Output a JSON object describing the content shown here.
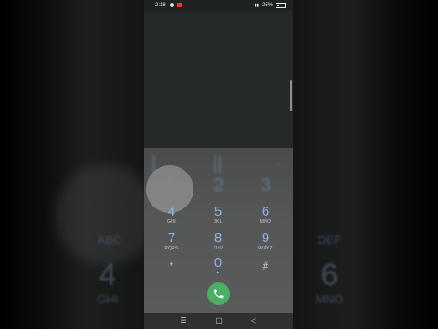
{
  "status_bar": {
    "time": "2:18",
    "battery": "25%"
  },
  "dialpad": {
    "keys": [
      {
        "num": "4",
        "letters": "GHI"
      },
      {
        "num": "5",
        "letters": "JKL"
      },
      {
        "num": "6",
        "letters": "MNO"
      },
      {
        "num": "7",
        "letters": "PQRS"
      },
      {
        "num": "8",
        "letters": "TUV"
      },
      {
        "num": "9",
        "letters": "WXYZ"
      },
      {
        "num": "*",
        "letters": ""
      },
      {
        "num": "0",
        "letters": "+"
      },
      {
        "num": "#",
        "letters": ""
      }
    ]
  },
  "side_blur": {
    "left_letters": "ABC",
    "left_num": "4",
    "left_let": "GHI",
    "right_letters": "DEF",
    "right_num": "6",
    "right_let": "MNO"
  },
  "colors": {
    "call_button": "#4caf64",
    "digit": "#8fb2e4"
  }
}
